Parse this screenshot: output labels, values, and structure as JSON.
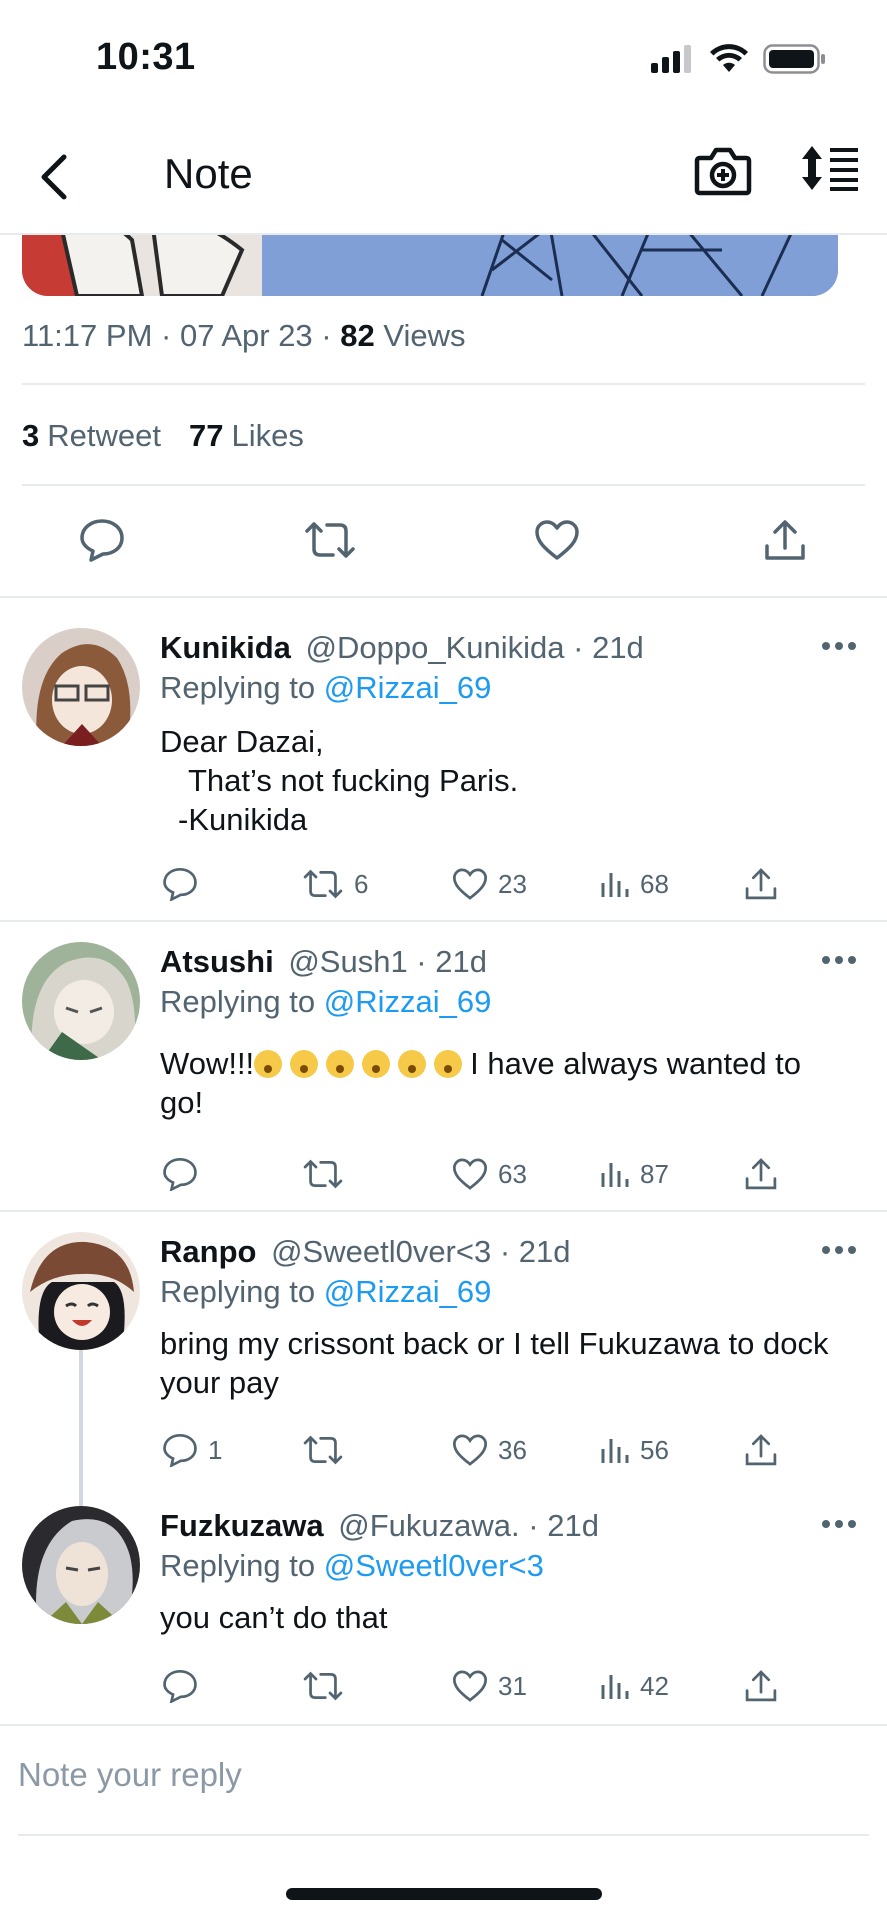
{
  "status_bar": {
    "time": "10:31"
  },
  "nav": {
    "title": "Note"
  },
  "tweet": {
    "time": "11:17 PM",
    "date": "07 Apr 23",
    "views_count": "82",
    "views_label": "Views",
    "retweets_count": "3",
    "retweets_label": "Retweet",
    "likes_count": "77",
    "likes_label": "Likes"
  },
  "replies": [
    {
      "name": "Kunikida",
      "handle": "@Doppo_Kunikida",
      "age": "21d",
      "replying_prefix": "Replying to",
      "replying_to": "@Rizzai_69",
      "lines": [
        "Dear Dazai,",
        "That’s not fucking Paris.",
        "-Kunikida"
      ],
      "comments": "",
      "retweets": "6",
      "likes": "23",
      "views": "68"
    },
    {
      "name": "Atsushi",
      "handle": "@Sush1",
      "age": "21d",
      "replying_prefix": "Replying to",
      "replying_to": "@Rizzai_69",
      "text_a": "Wow!!!",
      "text_b": "I have always wanted to go!",
      "comments": "",
      "retweets": "",
      "likes": "63",
      "views": "87"
    },
    {
      "name": "Ranpo",
      "handle": "@Sweetl0ver<3",
      "age": "21d",
      "replying_prefix": "Replying to",
      "replying_to": "@Rizzai_69",
      "text": "bring my crissont back or I tell Fukuzawa to dock your pay",
      "comments": "1",
      "retweets": "",
      "likes": "36",
      "views": "56"
    },
    {
      "name": "Fuzkuzawa",
      "handle": "@Fukuzawa.",
      "age": "21d",
      "replying_prefix": "Replying to",
      "replying_to": "@Sweetl0ver<3",
      "text": "you can’t do that",
      "comments": "",
      "retweets": "",
      "likes": "31",
      "views": "42"
    }
  ],
  "composer": {
    "placeholder": "Note your reply"
  },
  "colors": {
    "accent": "#1d9bf0",
    "muted": "#536471",
    "text": "#0f1419",
    "divider": "#e8ebed"
  },
  "icons": [
    "back-arrow-icon",
    "camera-plus-icon",
    "sort-lines-icon",
    "comment-icon",
    "retweet-icon",
    "heart-icon",
    "share-icon",
    "views-bar-icon",
    "more-dots-icon",
    "signal-icon",
    "wifi-icon",
    "battery-icon"
  ]
}
